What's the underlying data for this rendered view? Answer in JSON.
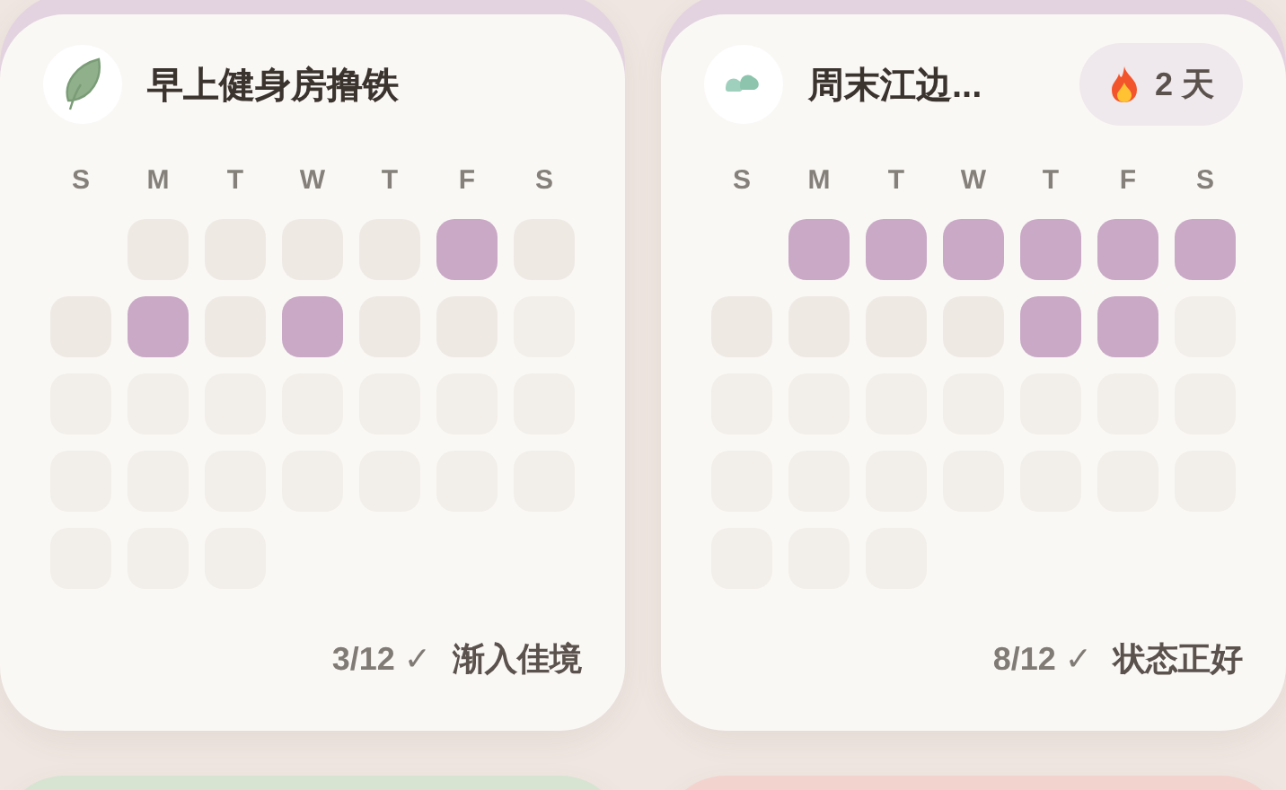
{
  "cards": [
    {
      "color": "#e3d3e0",
      "weekdays": [
        "S",
        "M",
        "T",
        "W",
        "T",
        "F",
        "S"
      ],
      "title": "早上健身房撸铁",
      "count": "3/12 ✓",
      "status": "渐入佳境",
      "weeks": [
        [
          {
            "kind": "blank"
          },
          {
            "kind": "empty"
          },
          {
            "kind": "empty"
          },
          {
            "kind": "empty"
          },
          {
            "kind": "empty"
          },
          {
            "kind": "done"
          },
          {
            "kind": "empty"
          }
        ],
        [
          {
            "kind": "empty"
          },
          {
            "kind": "done"
          },
          {
            "kind": "empty"
          },
          {
            "kind": "done"
          },
          {
            "kind": "empty"
          },
          {
            "kind": "empty"
          },
          {
            "kind": "future"
          }
        ],
        [
          {
            "kind": "future"
          },
          {
            "kind": "future"
          },
          {
            "kind": "future"
          },
          {
            "kind": "future"
          },
          {
            "kind": "future"
          },
          {
            "kind": "future"
          },
          {
            "kind": "future"
          }
        ],
        [
          {
            "kind": "future"
          },
          {
            "kind": "future"
          },
          {
            "kind": "future"
          },
          {
            "kind": "future"
          },
          {
            "kind": "future"
          },
          {
            "kind": "future"
          },
          {
            "kind": "future"
          }
        ],
        [
          {
            "kind": "future"
          },
          {
            "kind": "future"
          },
          {
            "kind": "future"
          }
        ]
      ]
    },
    {
      "color": "#e3d3e0",
      "weekdays": [
        "S",
        "M",
        "T",
        "W",
        "T",
        "F",
        "S"
      ],
      "title": "周末江边...",
      "badge": {
        "text": "2 天"
      },
      "count": "8/12 ✓",
      "status": "状态正好",
      "weeks": [
        [
          {
            "kind": "blank"
          },
          {
            "kind": "done"
          },
          {
            "kind": "done"
          },
          {
            "kind": "done"
          },
          {
            "kind": "done"
          },
          {
            "kind": "done"
          },
          {
            "kind": "done"
          }
        ],
        [
          {
            "kind": "empty"
          },
          {
            "kind": "empty"
          },
          {
            "kind": "empty"
          },
          {
            "kind": "empty"
          },
          {
            "kind": "done"
          },
          {
            "kind": "done"
          },
          {
            "kind": "future"
          }
        ],
        [
          {
            "kind": "future"
          },
          {
            "kind": "future"
          },
          {
            "kind": "future"
          },
          {
            "kind": "future"
          },
          {
            "kind": "future"
          },
          {
            "kind": "future"
          },
          {
            "kind": "future"
          }
        ],
        [
          {
            "kind": "future"
          },
          {
            "kind": "future"
          },
          {
            "kind": "future"
          },
          {
            "kind": "future"
          },
          {
            "kind": "future"
          },
          {
            "kind": "future"
          },
          {
            "kind": "future"
          }
        ],
        [
          {
            "kind": "future"
          },
          {
            "kind": "future"
          },
          {
            "kind": "future"
          }
        ]
      ]
    },
    {
      "color": "#d7e4d2"
    },
    {
      "color": "#f3d3cd"
    }
  ]
}
